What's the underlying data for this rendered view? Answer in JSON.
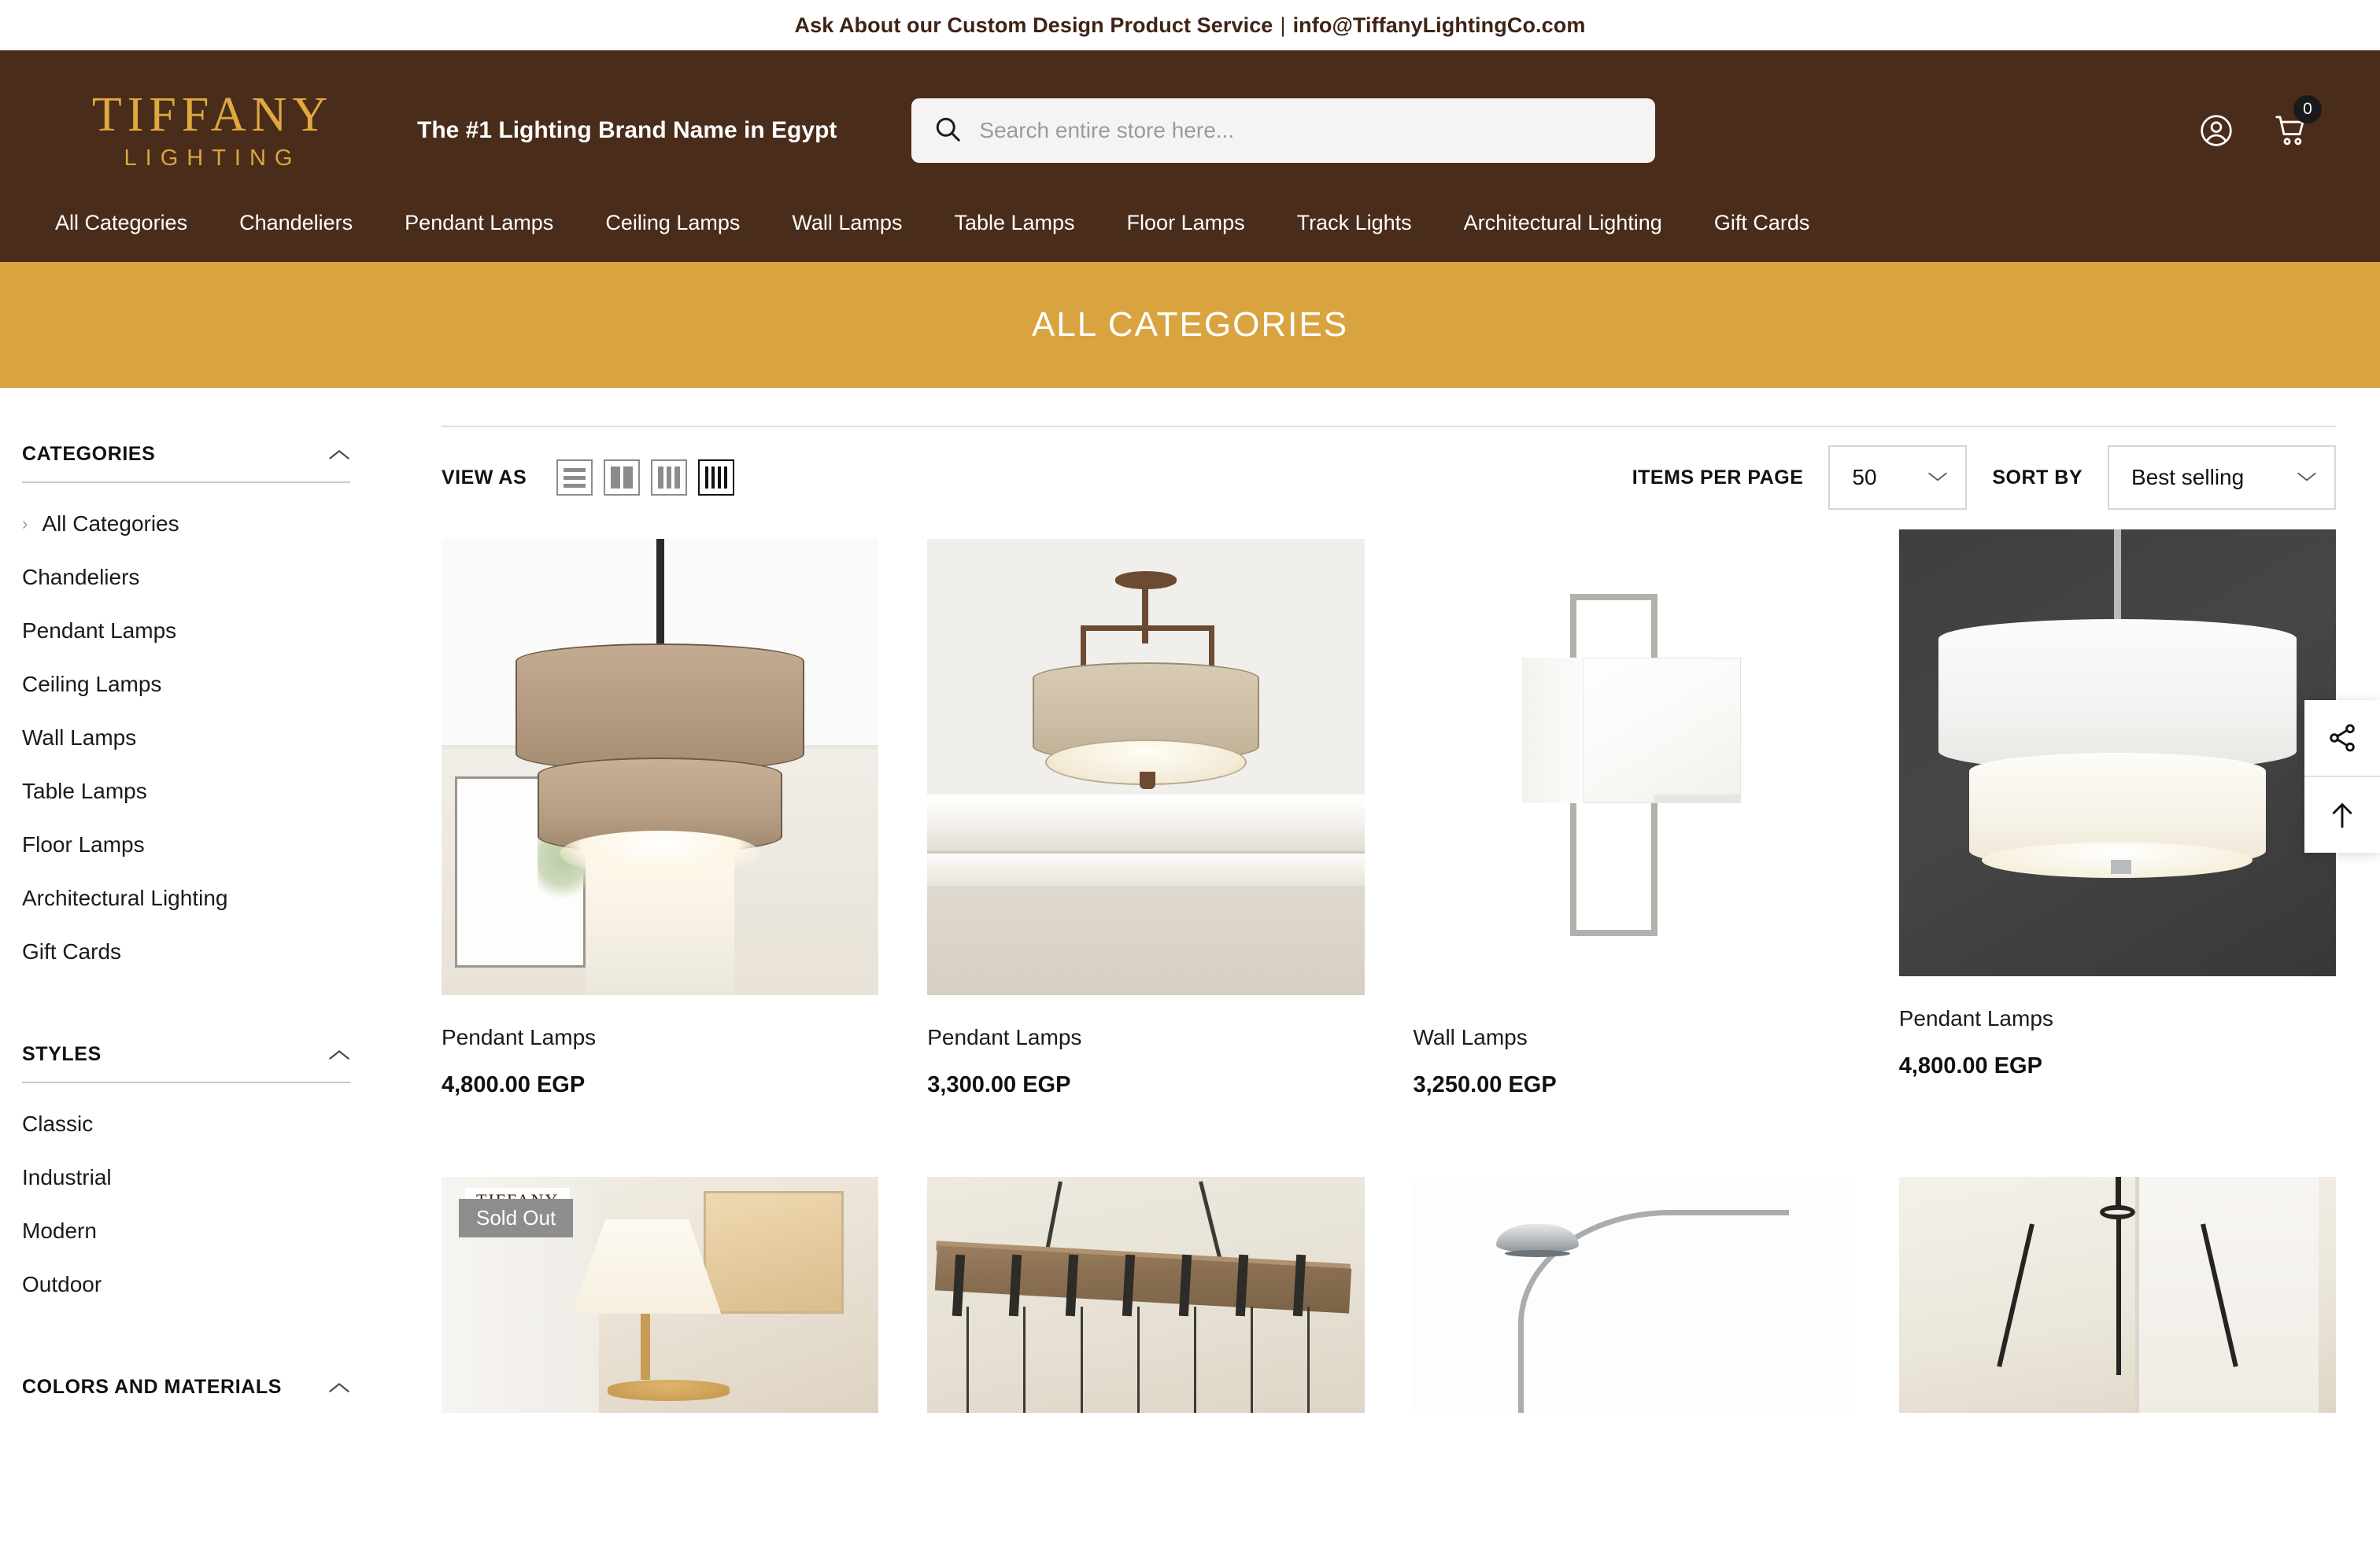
{
  "announcement": {
    "text": "Ask About our Custom Design Product Service",
    "separator": "|",
    "email": "info@TiffanyLightingCo.com"
  },
  "header": {
    "logo_main": "TIFFANY",
    "logo_sub": "LIGHTING",
    "tagline": "The #1 Lighting Brand Name in Egypt",
    "search_placeholder": "Search entire store here...",
    "search_value": "",
    "cart_count": "0",
    "brand_brown": "#4a2c1b",
    "brand_gold": "#d9a440"
  },
  "nav": {
    "items": [
      {
        "label": "All Categories"
      },
      {
        "label": "Chandeliers"
      },
      {
        "label": "Pendant Lamps"
      },
      {
        "label": "Ceiling Lamps"
      },
      {
        "label": "Wall Lamps"
      },
      {
        "label": "Table Lamps"
      },
      {
        "label": "Floor Lamps"
      },
      {
        "label": "Track Lights"
      },
      {
        "label": "Architectural Lighting"
      },
      {
        "label": "Gift Cards"
      }
    ]
  },
  "page_banner": {
    "title": "ALL CATEGORIES"
  },
  "sidebar": {
    "categories": {
      "title": "CATEGORIES",
      "items": [
        {
          "label": "All Categories"
        },
        {
          "label": "Chandeliers"
        },
        {
          "label": "Pendant Lamps"
        },
        {
          "label": "Ceiling Lamps"
        },
        {
          "label": "Wall Lamps"
        },
        {
          "label": "Table Lamps"
        },
        {
          "label": "Floor Lamps"
        },
        {
          "label": "Architectural Lighting"
        },
        {
          "label": "Gift Cards"
        }
      ]
    },
    "styles": {
      "title": "STYLES",
      "items": [
        {
          "label": "Classic"
        },
        {
          "label": "Industrial"
        },
        {
          "label": "Modern"
        },
        {
          "label": "Outdoor"
        }
      ]
    },
    "colors_materials": {
      "title": "COLORS AND MATERIALS"
    }
  },
  "toolbar": {
    "view_as_label": "VIEW AS",
    "view_options": [
      {
        "name": "list-view",
        "active": false
      },
      {
        "name": "two-column-view",
        "active": false
      },
      {
        "name": "three-column-view",
        "active": false
      },
      {
        "name": "four-column-view",
        "active": true
      }
    ],
    "items_per_page_label": "ITEMS PER PAGE",
    "items_per_page_value": "50",
    "sort_by_label": "SORT BY",
    "sort_by_value": "Best selling"
  },
  "products": [
    {
      "title": "Pendant Lamps",
      "price": "4,800.00 EGP",
      "badge": ""
    },
    {
      "title": "Pendant Lamps",
      "price": "3,300.00 EGP",
      "badge": ""
    },
    {
      "title": "Wall Lamps",
      "price": "3,250.00 EGP",
      "badge": ""
    },
    {
      "title": "Pendant Lamps",
      "price": "4,800.00 EGP",
      "badge": ""
    }
  ],
  "products_row2": [
    {
      "badge": "Sold Out",
      "watermark": "TIFFANY"
    },
    {
      "badge": "",
      "watermark": ""
    },
    {
      "badge": "",
      "watermark": ""
    },
    {
      "badge": "",
      "watermark": ""
    }
  ],
  "side_float": {
    "share": "share-icon",
    "scroll_top": "arrow-up-icon"
  }
}
